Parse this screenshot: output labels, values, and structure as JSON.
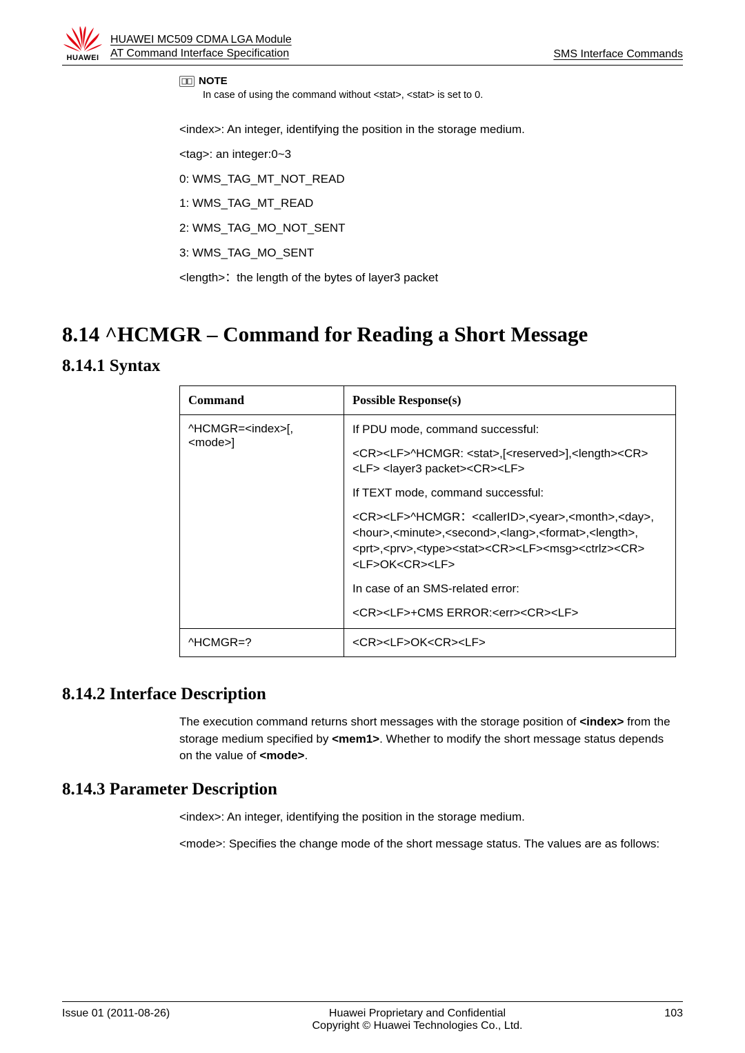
{
  "header": {
    "logo_text": "HUAWEI",
    "doc_title_line1": "HUAWEI MC509 CDMA LGA Module",
    "doc_title_line2": "AT Command Interface Specification",
    "right": "SMS Interface Commands"
  },
  "note": {
    "label": "NOTE",
    "text": "In case of using the command without <stat>, <stat> is set to 0."
  },
  "pre_paras": [
    "<index>: An integer, identifying the position in the storage medium.",
    "<tag>: an integer:0~3",
    "0: WMS_TAG_MT_NOT_READ",
    "1: WMS_TAG_MT_READ",
    "2: WMS_TAG_MO_NOT_SENT",
    "3: WMS_TAG_MO_SENT",
    "<length>：the length of the bytes of layer3 packet"
  ],
  "section": {
    "h1": "8.14 ^HCMGR – Command for Reading a Short Message",
    "h2_syntax": "8.14.1 Syntax",
    "h2_intf": "8.14.2 Interface Description",
    "h2_param": "8.14.3 Parameter Description"
  },
  "table": {
    "head_cmd": "Command",
    "head_resp": "Possible Response(s)",
    "row1_cmd": "^HCMGR=<index>[,<mode>]",
    "row1_resp": [
      "If PDU mode, command successful:",
      "<CR><LF>^HCMGR: <stat>,[<reserved>],<length><CR><LF> <layer3 packet><CR><LF>",
      "If TEXT mode, command successful:",
      "<CR><LF>^HCMGR：<callerID>,<year>,<month>,<day>,<hour>,<minute>,<second>,<lang>,<format>,<length>,<prt>,<prv>,<type><stat><CR><LF><msg><ctrlz><CR><LF>OK<CR><LF>",
      "In case of an SMS-related error:",
      "<CR><LF>+CMS ERROR:<err><CR><LF>"
    ],
    "row2_cmd": "^HCMGR=?",
    "row2_resp": "<CR><LF>OK<CR><LF>"
  },
  "intf_desc": {
    "pre": "The execution command returns short messages with the storage position of ",
    "b1": "<index>",
    "mid1": " from the storage medium specified by ",
    "b2": "<mem1>",
    "mid2": ". Whether to modify the short message status depends on the value of ",
    "b3": "<mode>",
    "post": "."
  },
  "param_desc": [
    "<index>: An integer, identifying the position in the storage medium.",
    "<mode>: Specifies the change mode of the short message status. The values are as follows:"
  ],
  "footer": {
    "left": "Issue 01 (2011-08-26)",
    "center1": "Huawei Proprietary and Confidential",
    "center2": "Copyright © Huawei Technologies Co., Ltd.",
    "right": "103"
  }
}
